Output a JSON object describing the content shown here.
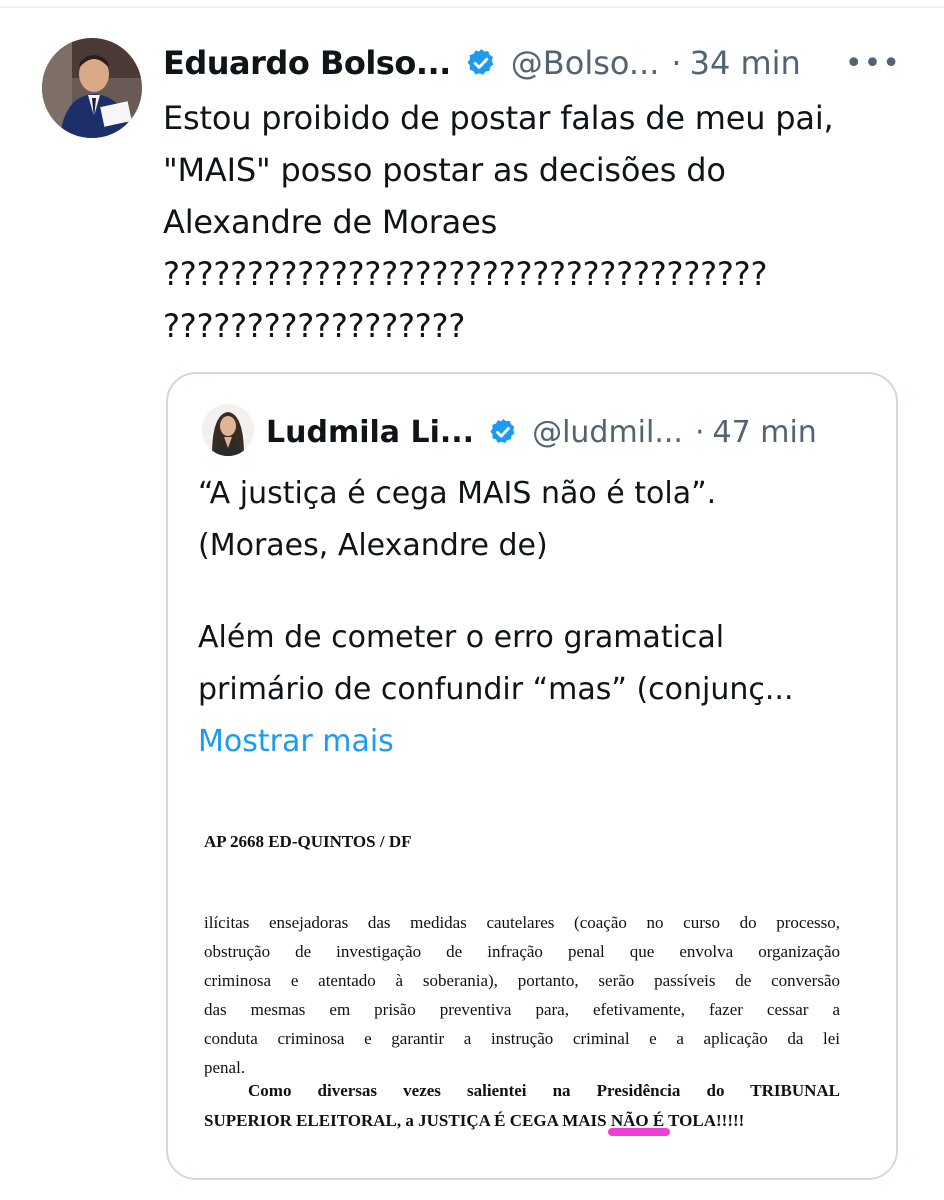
{
  "tweet": {
    "author_name": "Eduardo Bolso...",
    "handle": "@Bolso...",
    "separator": "·",
    "time": "34 min",
    "more": "•••",
    "text_lines": [
      "Estou proibido de postar falas de meu pai,",
      "\"MAIS\" posso postar as decisões do",
      "Alexandre de Moraes",
      "????????????????????????????????????",
      "??????????????????"
    ]
  },
  "quoted_tweet": {
    "author_name": "Ludmila Li...",
    "handle": "@ludmil...",
    "separator": "·",
    "time": "47 min",
    "text_lines_1": [
      "“A justiça é cega MAIS não é tola”.",
      "(Moraes, Alexandre de)"
    ],
    "text_lines_2": [
      "Além de cometer o erro gramatical",
      "primário de confundir “mas” (conjunç..."
    ],
    "show_more": "Mostrar mais",
    "document": {
      "heading": "AP 2668 ED-QUINTOS / DF",
      "body_lines": [
        "ilícitas ensejadoras das medidas cautelares (coação no curso do processo,",
        "obstrução de investigação de infração penal que envolva organização",
        "criminosa e atentado à soberania), portanto, serão passíveis de conversão",
        "das mesmas em prisão preventiva para, efetivamente, fazer cessar a",
        "conduta criminosa e garantir a instrução criminal e a aplicação da lei",
        "penal."
      ],
      "quote_lines": [
        "Como diversas vezes salientei na Presidência do TRIBUNAL",
        "SUPERIOR ELEITORAL, a JUSTIÇA É CEGA MAIS NÃO É TOLA!!!!!"
      ],
      "highlight_color": "#ef3ed8"
    }
  },
  "colors": {
    "verified_blue": "#1d9bf0",
    "link_blue": "#1d9bf0",
    "secondary_text": "#536471",
    "border": "#cfd9de"
  },
  "icons": {
    "verified": "verified-badge-icon",
    "more": "more-options-icon"
  }
}
